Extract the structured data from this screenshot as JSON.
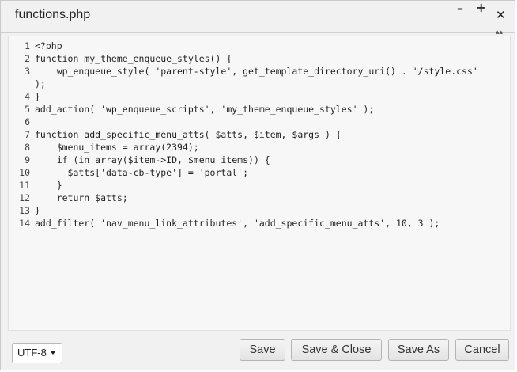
{
  "window": {
    "title": "functions.php",
    "minimize_icon": "minimize-icon",
    "maximize_icon": "maximize-icon",
    "close_icon": "close-icon"
  },
  "editor": {
    "lines": [
      {
        "num": "1",
        "text": "<?php"
      },
      {
        "num": "2",
        "text": "function my_theme_enqueue_styles() {"
      },
      {
        "num": "3",
        "text": "    wp_enqueue_style( 'parent-style', get_template_directory_uri() . '/style.css'",
        "continuation": ");"
      },
      {
        "num": "4",
        "text": "}"
      },
      {
        "num": "5",
        "text": "add_action( 'wp_enqueue_scripts', 'my_theme_enqueue_styles' );"
      },
      {
        "num": "6",
        "text": ""
      },
      {
        "num": "7",
        "text": "function add_specific_menu_atts( $atts, $item, $args ) {"
      },
      {
        "num": "8",
        "text": "    $menu_items = array(2394);"
      },
      {
        "num": "9",
        "text": "    if (in_array($item->ID, $menu_items)) {"
      },
      {
        "num": "10",
        "text": "      $atts['data-cb-type'] = 'portal';"
      },
      {
        "num": "11",
        "text": "    }"
      },
      {
        "num": "12",
        "text": "    return $atts;"
      },
      {
        "num": "13",
        "text": "}"
      },
      {
        "num": "14",
        "text": "add_filter( 'nav_menu_link_attributes', 'add_specific_menu_atts', 10, 3 );"
      }
    ]
  },
  "footer": {
    "encoding": "UTF-8",
    "save_label": "Save",
    "save_close_label": "Save & Close",
    "save_as_label": "Save As",
    "cancel_label": "Cancel"
  }
}
